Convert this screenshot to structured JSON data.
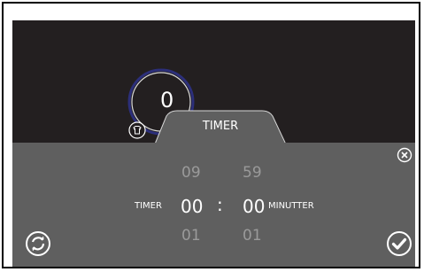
{
  "dial": {
    "value": "0"
  },
  "tab": {
    "label": "TIMER"
  },
  "timer": {
    "label": "TIMER",
    "hours": {
      "prev": "09",
      "current": "00",
      "next": "01"
    },
    "minutes": {
      "prev": "59",
      "current": "00",
      "next": "01"
    },
    "separator": ":",
    "unit_label": "MINUTTER"
  },
  "icons": {
    "shirt": "shirt-icon",
    "close": "close-icon",
    "reset": "reset-icon",
    "confirm": "confirm-icon"
  },
  "colors": {
    "screen_bg": "#231f20",
    "panel_bg": "#5f5f5f",
    "dial_ring": "#2c2f7a",
    "text_active": "#ffffff",
    "text_inactive": "#9a9a9a"
  }
}
